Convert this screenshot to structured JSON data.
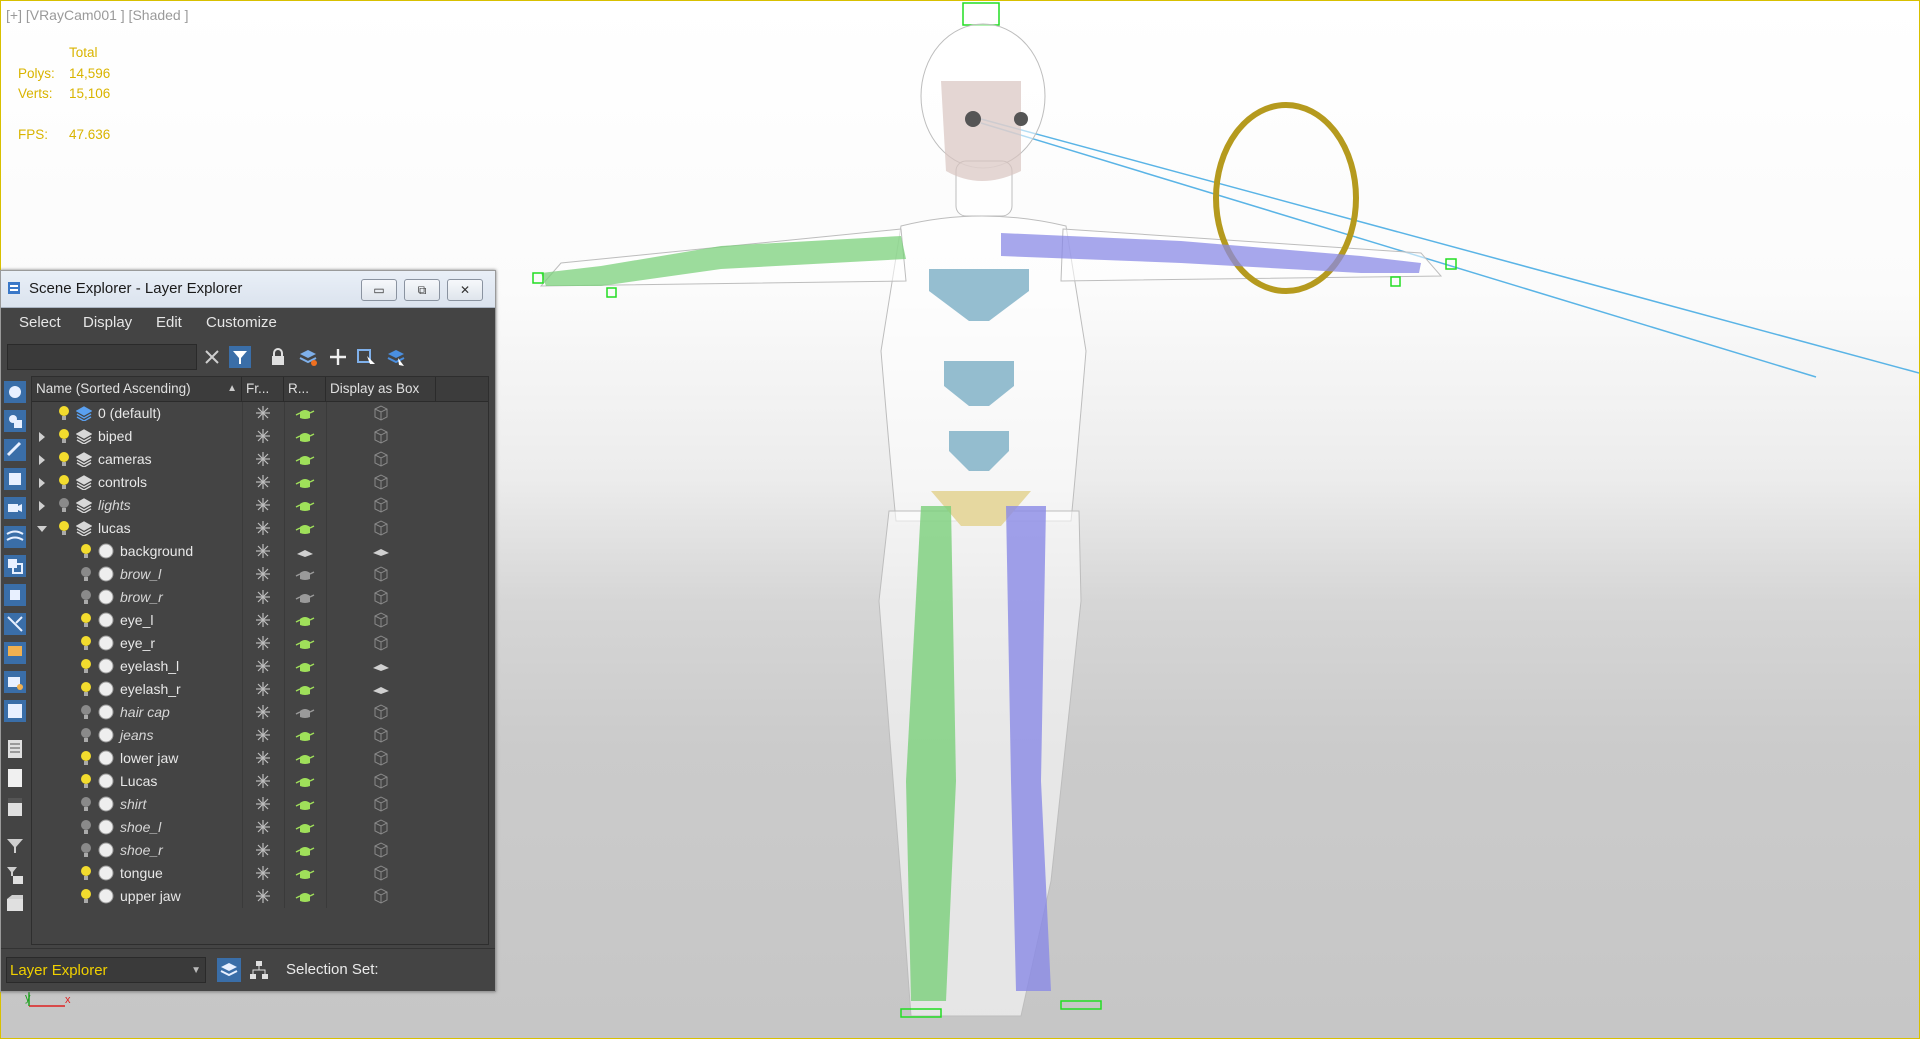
{
  "viewport": {
    "label": "[+] [VRayCam001 ] [Shaded ]",
    "stats": {
      "header": "Total",
      "polys_label": "Polys:",
      "polys_value": "14,596",
      "verts_label": "Verts:",
      "verts_value": "15,106",
      "fps_label": "FPS:",
      "fps_value": "47.636"
    },
    "axis_x": "x",
    "axis_y": "y",
    "colors": {
      "stats": "#d9b400",
      "border": "#d8c000"
    }
  },
  "scene_explorer": {
    "title": "Scene Explorer - Layer Explorer",
    "window_buttons": {
      "minimize": "▭",
      "restore": "⧉",
      "close": "✕"
    },
    "menu": [
      "Select",
      "Display",
      "Edit",
      "Customize"
    ],
    "search_value": "",
    "columns": [
      "Name (Sorted Ascending)",
      "Fr...",
      "R...",
      "Display as Box"
    ],
    "rows": [
      {
        "name": "0 (default)",
        "level": 0,
        "expander": "",
        "bulb": "on",
        "italic": false,
        "type": "layer-active",
        "render": "on",
        "box": "box"
      },
      {
        "name": "biped",
        "level": 0,
        "expander": "collapsed",
        "bulb": "on",
        "italic": false,
        "type": "layer",
        "render": "on",
        "box": "box"
      },
      {
        "name": "cameras",
        "level": 0,
        "expander": "collapsed",
        "bulb": "on",
        "italic": false,
        "type": "layer",
        "render": "on",
        "box": "box"
      },
      {
        "name": "controls",
        "level": 0,
        "expander": "collapsed",
        "bulb": "on",
        "italic": false,
        "type": "layer",
        "render": "on",
        "box": "box"
      },
      {
        "name": "lights",
        "level": 0,
        "expander": "collapsed",
        "bulb": "off",
        "italic": true,
        "type": "layer",
        "render": "on",
        "box": "box"
      },
      {
        "name": "lucas",
        "level": 0,
        "expander": "expanded",
        "bulb": "on",
        "italic": false,
        "type": "layer",
        "render": "on",
        "box": "box"
      },
      {
        "name": "background",
        "level": 1,
        "expander": "",
        "bulb": "on",
        "italic": false,
        "type": "object",
        "render": "flat",
        "box": "flat"
      },
      {
        "name": "brow_l",
        "level": 1,
        "expander": "",
        "bulb": "off",
        "italic": true,
        "type": "object",
        "render": "dim",
        "box": "box"
      },
      {
        "name": "brow_r",
        "level": 1,
        "expander": "",
        "bulb": "off",
        "italic": true,
        "type": "object",
        "render": "dim",
        "box": "box"
      },
      {
        "name": "eye_l",
        "level": 1,
        "expander": "",
        "bulb": "on",
        "italic": false,
        "type": "object",
        "render": "on",
        "box": "box"
      },
      {
        "name": "eye_r",
        "level": 1,
        "expander": "",
        "bulb": "on",
        "italic": false,
        "type": "object",
        "render": "on",
        "box": "box"
      },
      {
        "name": "eyelash_l",
        "level": 1,
        "expander": "",
        "bulb": "on",
        "italic": false,
        "type": "object",
        "render": "on",
        "box": "flat"
      },
      {
        "name": "eyelash_r",
        "level": 1,
        "expander": "",
        "bulb": "on",
        "italic": false,
        "type": "object",
        "render": "on",
        "box": "flat"
      },
      {
        "name": "hair cap",
        "level": 1,
        "expander": "",
        "bulb": "off",
        "italic": true,
        "type": "object",
        "render": "dim",
        "box": "box"
      },
      {
        "name": "jeans",
        "level": 1,
        "expander": "",
        "bulb": "off",
        "italic": true,
        "type": "object",
        "render": "on",
        "box": "box"
      },
      {
        "name": "lower jaw",
        "level": 1,
        "expander": "",
        "bulb": "on",
        "italic": false,
        "type": "object",
        "render": "on",
        "box": "box"
      },
      {
        "name": "Lucas",
        "level": 1,
        "expander": "",
        "bulb": "on",
        "italic": false,
        "type": "object",
        "render": "on",
        "box": "box"
      },
      {
        "name": "shirt",
        "level": 1,
        "expander": "",
        "bulb": "off",
        "italic": true,
        "type": "object",
        "render": "on",
        "box": "box"
      },
      {
        "name": "shoe_l",
        "level": 1,
        "expander": "",
        "bulb": "off",
        "italic": true,
        "type": "object",
        "render": "on",
        "box": "box"
      },
      {
        "name": "shoe_r",
        "level": 1,
        "expander": "",
        "bulb": "off",
        "italic": true,
        "type": "object",
        "render": "on",
        "box": "box"
      },
      {
        "name": "tongue",
        "level": 1,
        "expander": "",
        "bulb": "on",
        "italic": false,
        "type": "object",
        "render": "on",
        "box": "box"
      },
      {
        "name": "upper jaw",
        "level": 1,
        "expander": "",
        "bulb": "on",
        "italic": false,
        "type": "object",
        "render": "on",
        "box": "box"
      }
    ],
    "status": {
      "explorer_combo": "Layer Explorer",
      "selection_set_label": "Selection Set:"
    },
    "colors": {
      "bulb_on": "#f3dc2e",
      "bulb_off": "#8a8a8a",
      "teapot": "#9fe05a",
      "combo_text": "#f0d000"
    }
  }
}
